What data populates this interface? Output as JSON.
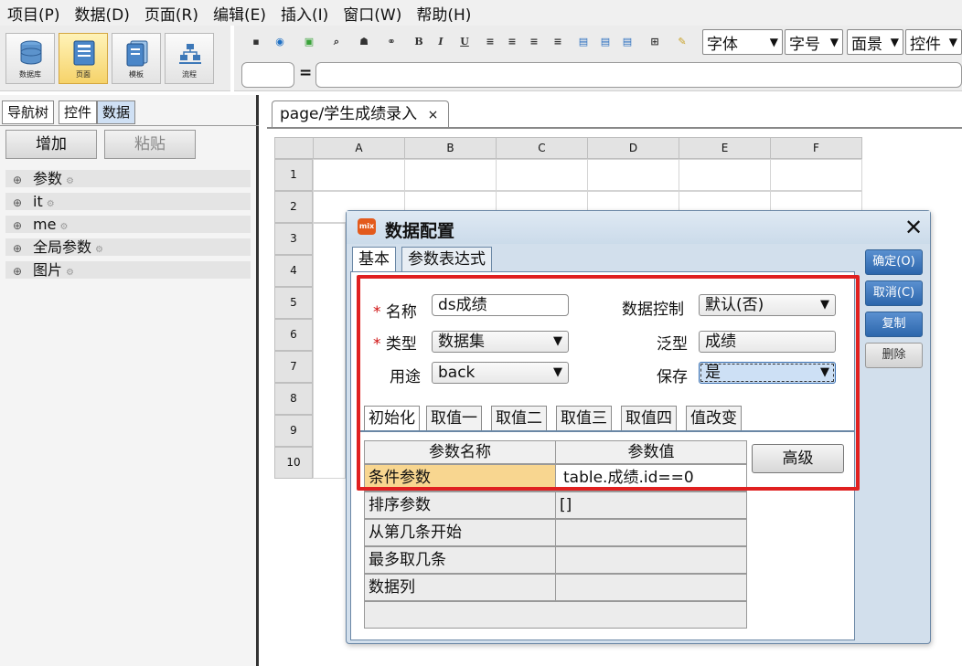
{
  "menu": [
    "项目(P)",
    "数据(D)",
    "页面(R)",
    "编辑(E)",
    "插入(I)",
    "窗口(W)",
    "帮助(H)"
  ],
  "toolbar_left": {
    "buttons": [
      {
        "label": "数据库",
        "icon": "database-icon"
      },
      {
        "label": "页面",
        "icon": "page-icon"
      },
      {
        "label": "模板",
        "icon": "template-icon"
      },
      {
        "label": "流程",
        "icon": "flow-icon"
      }
    ]
  },
  "toolbar_right": {
    "font": "字体",
    "size": "字号",
    "bg": "面景",
    "ctrl": "控件"
  },
  "formula": {
    "eq": "="
  },
  "left_panel": {
    "tabs": [
      "导航树",
      "控件",
      "数据"
    ],
    "add": "增加",
    "paste": "粘贴",
    "tree": [
      "参数",
      "it",
      "me",
      "全局参数",
      "图片"
    ]
  },
  "doc": {
    "tab": "page/学生成绩录入",
    "close": "×"
  },
  "grid": {
    "cols": [
      "A",
      "B",
      "C",
      "D",
      "E",
      "F"
    ],
    "rows": [
      "1",
      "2",
      "3",
      "4",
      "5",
      "6",
      "7",
      "8",
      "9",
      "10"
    ]
  },
  "dialog": {
    "title": "数据配置",
    "icon_text": "mix",
    "close": "✕",
    "tabs": [
      "基本",
      "参数表达式"
    ],
    "req_mark": "*",
    "name_label": "名称",
    "name_value": "ds成绩",
    "type_label": "类型",
    "type_value": "数据集",
    "use_label": "用途",
    "use_value": "back",
    "control_label": "数据控制",
    "control_value": "默认(否)",
    "generic_label": "泛型",
    "generic_value": "成绩",
    "save_label": "保存",
    "save_value": "是",
    "subtabs": [
      "初始化",
      "取值一",
      "取值二",
      "取值三",
      "取值四",
      "值改变"
    ],
    "table": {
      "headers": [
        "参数名称",
        "参数值"
      ],
      "rows": [
        {
          "name": "条件参数",
          "value": "table.成绩.id==0"
        },
        {
          "name": "排序参数",
          "value": "[]"
        },
        {
          "name": "从第几条开始",
          "value": ""
        },
        {
          "name": "最多取几条",
          "value": ""
        },
        {
          "name": "数据列",
          "value": ""
        }
      ]
    },
    "advanced": "高级",
    "side_buttons": [
      "确定(O)",
      "取消(C)",
      "复制",
      "删除"
    ]
  }
}
